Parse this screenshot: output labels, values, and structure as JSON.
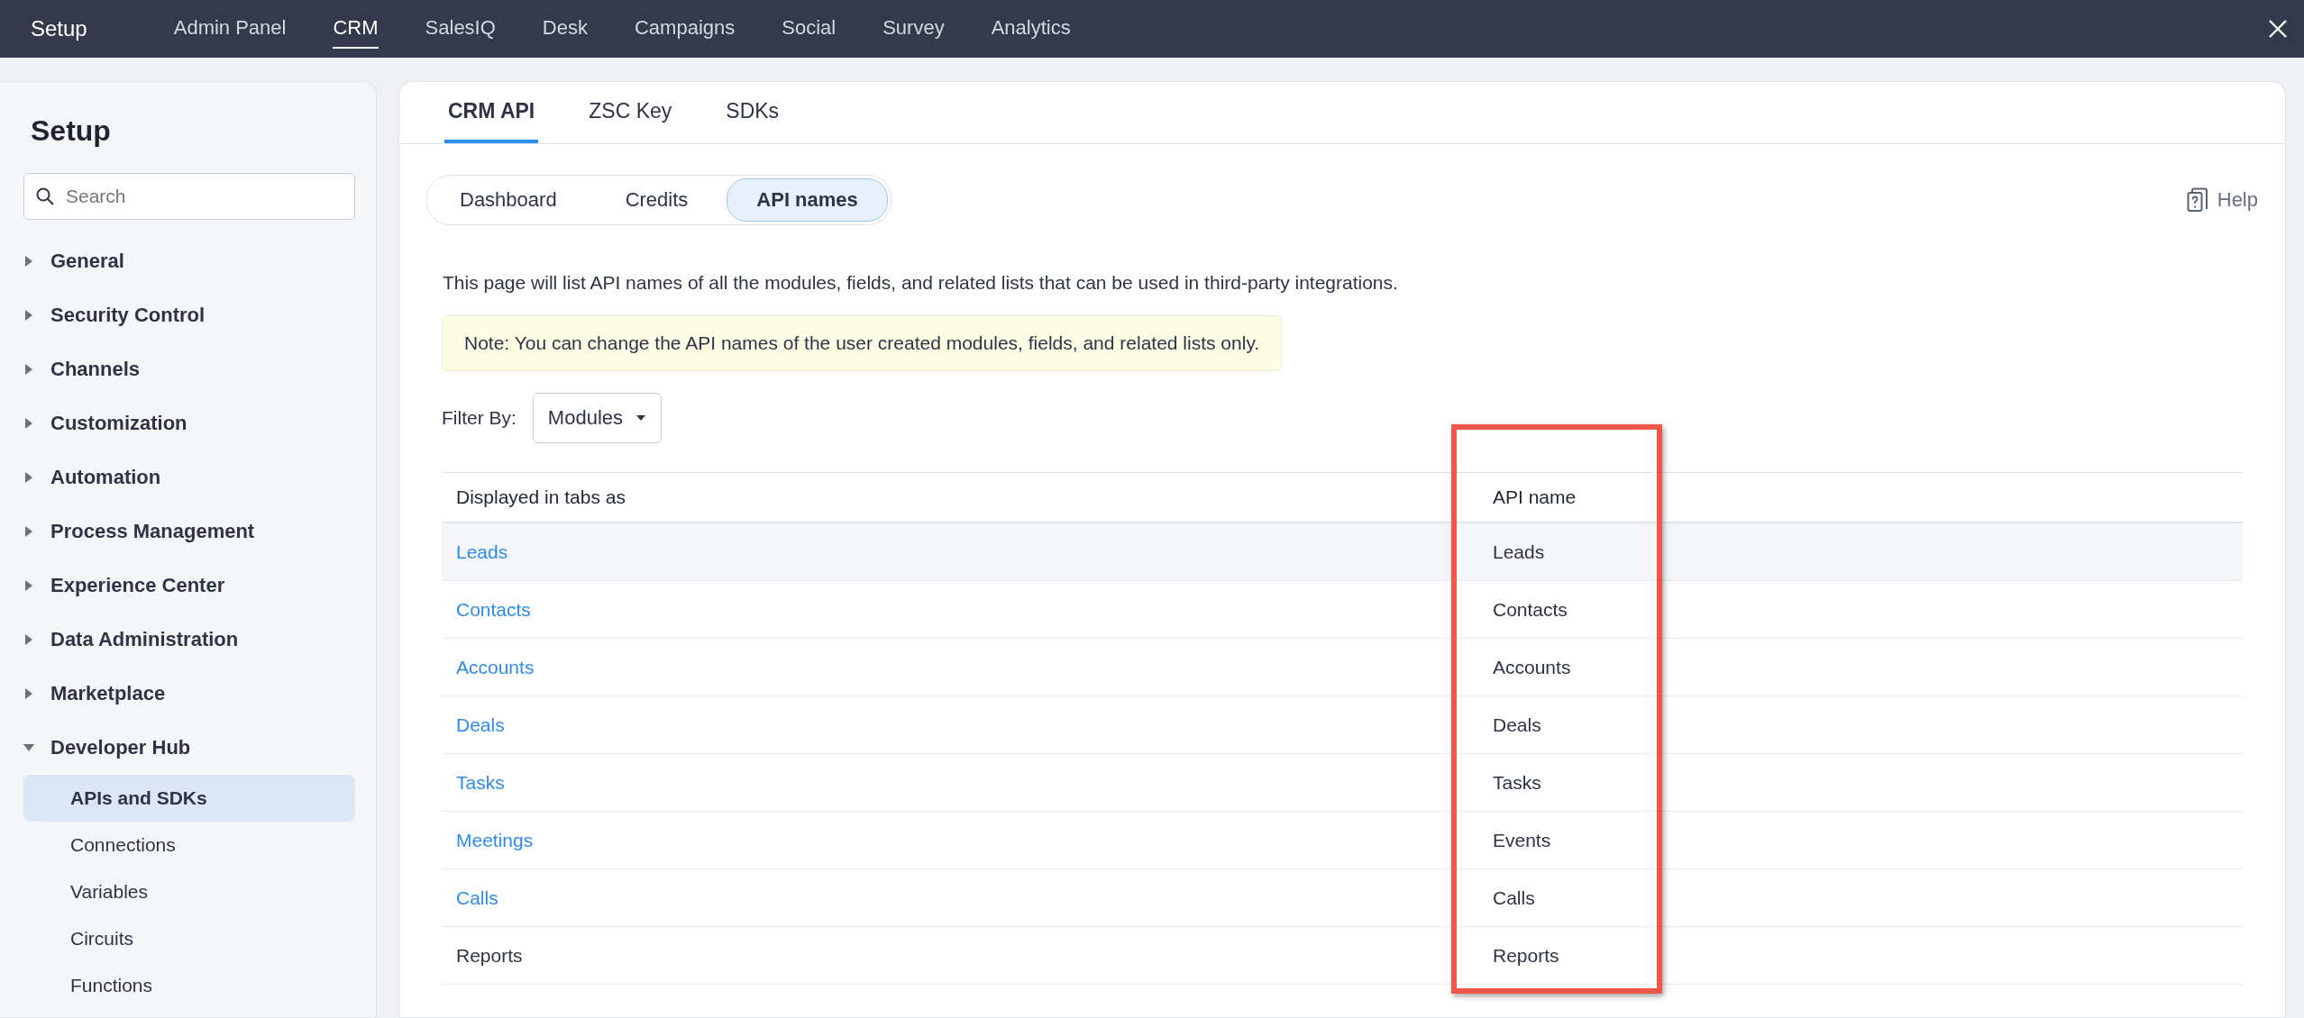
{
  "top_bar": {
    "title": "Setup",
    "apps": [
      {
        "label": "Admin Panel",
        "selected": false
      },
      {
        "label": "CRM",
        "selected": true
      },
      {
        "label": "SalesIQ",
        "selected": false
      },
      {
        "label": "Desk",
        "selected": false
      },
      {
        "label": "Campaigns",
        "selected": false
      },
      {
        "label": "Social",
        "selected": false
      },
      {
        "label": "Survey",
        "selected": false
      },
      {
        "label": "Analytics",
        "selected": false
      }
    ]
  },
  "sidebar": {
    "title": "Setup",
    "search": {
      "placeholder": "Search"
    },
    "items": [
      {
        "label": "General",
        "expanded": false
      },
      {
        "label": "Security Control",
        "expanded": false
      },
      {
        "label": "Channels",
        "expanded": false
      },
      {
        "label": "Customization",
        "expanded": false
      },
      {
        "label": "Automation",
        "expanded": false
      },
      {
        "label": "Process Management",
        "expanded": false
      },
      {
        "label": "Experience Center",
        "expanded": false
      },
      {
        "label": "Data Administration",
        "expanded": false
      },
      {
        "label": "Marketplace",
        "expanded": false
      },
      {
        "label": "Developer Hub",
        "expanded": true,
        "children": [
          {
            "label": "APIs and SDKs",
            "selected": true
          },
          {
            "label": "Connections",
            "selected": false
          },
          {
            "label": "Variables",
            "selected": false
          },
          {
            "label": "Circuits",
            "selected": false
          },
          {
            "label": "Functions",
            "selected": false
          }
        ]
      }
    ]
  },
  "tabs": [
    {
      "label": "CRM API",
      "selected": true
    },
    {
      "label": "ZSC Key",
      "selected": false
    },
    {
      "label": "SDKs",
      "selected": false
    }
  ],
  "subtabs": [
    {
      "label": "Dashboard",
      "selected": false
    },
    {
      "label": "Credits",
      "selected": false
    },
    {
      "label": "API names",
      "selected": true
    }
  ],
  "help": "Help",
  "description": "This page will list API names of all the modules, fields, and related lists that can be used in third-party integrations.",
  "note": "Note: You can change the API names of the user created modules, fields, and related lists only.",
  "filter": {
    "label": "Filter By:",
    "value": "Modules"
  },
  "table": {
    "columns": [
      {
        "label": "Displayed in tabs as",
        "highlighted": false
      },
      {
        "label": "API name",
        "highlighted": true
      }
    ],
    "rows": [
      {
        "cells": [
          "Leads",
          "Leads"
        ],
        "kind": "link",
        "highlighted": true
      },
      {
        "cells": [
          "Contacts",
          "Contacts"
        ],
        "kind": "link",
        "highlighted": false
      },
      {
        "cells": [
          "Accounts",
          "Accounts"
        ],
        "kind": "link",
        "highlighted": false
      },
      {
        "cells": [
          "Deals",
          "Deals"
        ],
        "kind": "link",
        "highlighted": false
      },
      {
        "cells": [
          "Tasks",
          "Tasks"
        ],
        "kind": "link",
        "highlighted": false
      },
      {
        "cells": [
          "Meetings",
          "Events"
        ],
        "kind": "link",
        "highlighted": false
      },
      {
        "cells": [
          "Calls",
          "Calls"
        ],
        "kind": "link",
        "highlighted": false
      },
      {
        "cells": [
          "Reports",
          "Reports"
        ],
        "kind": "text",
        "highlighted": false
      }
    ]
  }
}
